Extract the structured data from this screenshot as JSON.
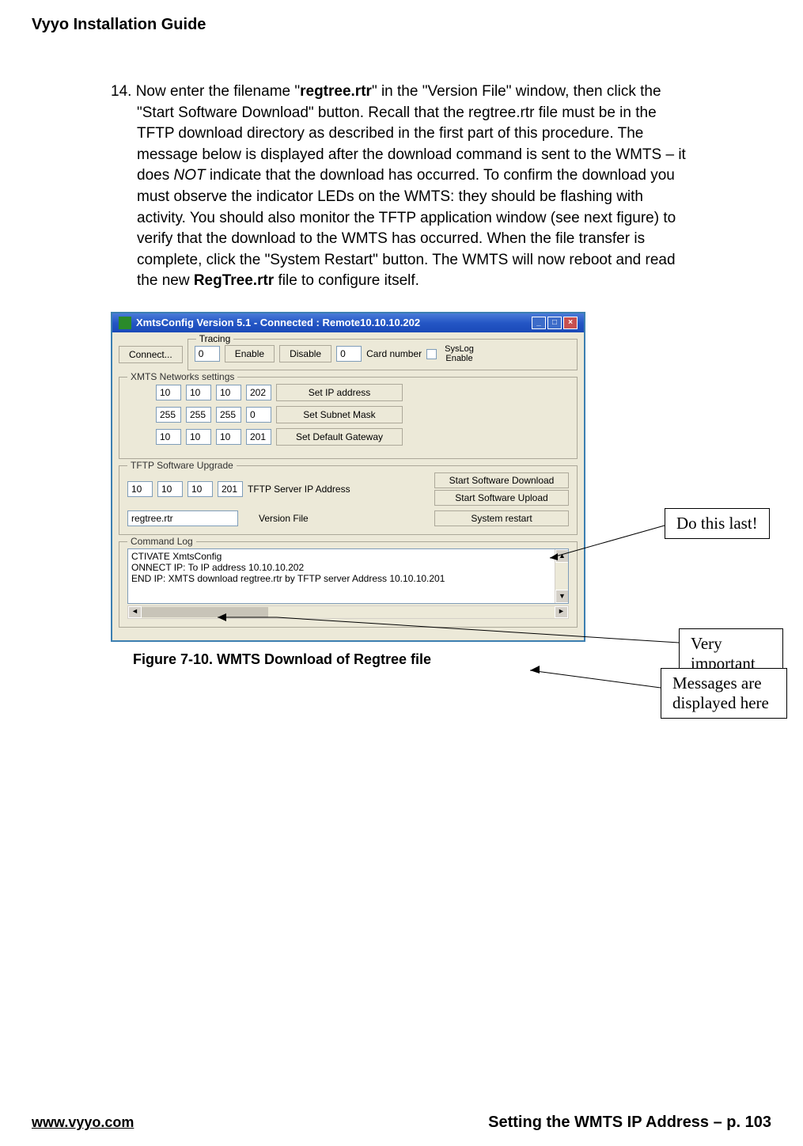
{
  "header": {
    "title": "Vyyo Installation Guide"
  },
  "instruction": {
    "number": "14.",
    "prefix": "Now enter the filename \"",
    "filename": "regtree.rtr",
    "mid1": "\" in the \"Version File\" window, then click the \"Start Software Download\" button.  Recall that the regtree.rtr file must be in the TFTP download directory as described in the first part of this procedure. The message below is displayed after the download command is sent to the WMTS – it does ",
    "not": "NOT",
    "mid2": " indicate that the download has occurred.  To confirm the download you must observe the indicator LEDs on the WMTS:  they should be flashing with activity.  You should also monitor the TFTP application window (see next figure) to verify that the download to the WMTS has occurred.  When the file transfer is complete, click the \"System Restart\" button. The WMTS will now reboot and read the new ",
    "regtree": "RegTree.rtr",
    "suffix": " file to configure itself."
  },
  "app": {
    "title": "XmtsConfig Version 5.1 - Connected : Remote10.10.10.202",
    "connect": "Connect...",
    "tracing": {
      "legend": "Tracing",
      "val1": "0",
      "enable": "Enable",
      "disable": "Disable",
      "val2": "0",
      "cardnumber": "Card number"
    },
    "syslog": {
      "line1": "SysLog",
      "line2": "Enable"
    },
    "xmts": {
      "legend": "XMTS Networks settings",
      "ip": [
        "10",
        "10",
        "10",
        "202"
      ],
      "set_ip": "Set IP address",
      "mask": [
        "255",
        "255",
        "255",
        "0"
      ],
      "set_mask": "Set Subnet Mask",
      "gw": [
        "10",
        "10",
        "10",
        "201"
      ],
      "set_gw": "Set Default Gateway"
    },
    "tftp": {
      "legend": "TFTP Software Upgrade",
      "server": [
        "10",
        "10",
        "10",
        "201"
      ],
      "server_label": "TFTP Server IP Address",
      "download": "Start Software Download",
      "upload": "Start Software Upload",
      "version_file": "regtree.rtr",
      "version_label": "Version File",
      "restart": "System restart"
    },
    "log": {
      "legend": "Command Log",
      "line1": "CTIVATE XmtsConfig",
      "line2": "ONNECT IP: To IP address 10.10.10.202",
      "line3": "END IP: XMTS download regtree.rtr by TFTP server Address 10.10.10.201"
    }
  },
  "callouts": {
    "last": "Do this last!",
    "important": "Very important",
    "messages": "Messages are displayed here"
  },
  "figure_caption": "Figure 7-10. WMTS Download of Regtree file",
  "footer": {
    "url": "www.vyyo.com",
    "page": "Setting the WMTS IP Address – p. 103"
  }
}
